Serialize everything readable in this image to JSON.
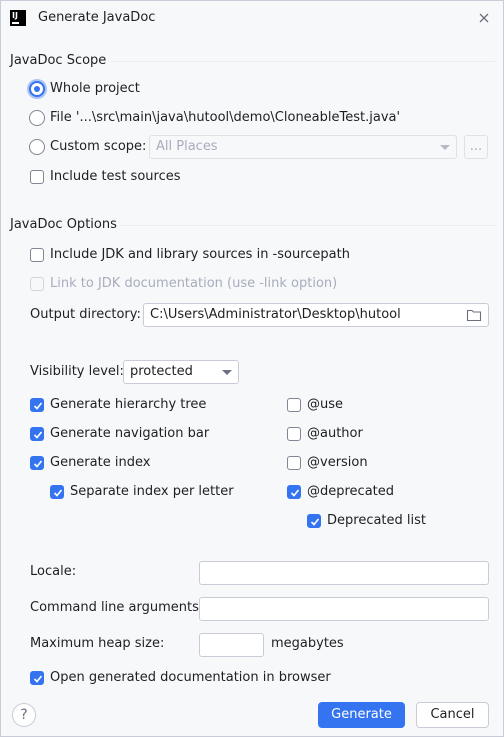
{
  "window": {
    "title": "Generate JavaDoc",
    "app_icon": "IJ"
  },
  "scope": {
    "section_title": "JavaDoc Scope",
    "whole_project_label": "Whole project",
    "file_label": "File '...\\src\\main\\java\\hutool\\demo\\CloneableTest.java'",
    "custom_scope_label": "Custom scope:",
    "custom_scope_value": "All Places",
    "browse_label": "...",
    "include_test_label": "Include test sources"
  },
  "options": {
    "section_title": "JavaDoc Options",
    "include_jdk_label": "Include JDK and library sources in -sourcepath",
    "link_jdk_label": "Link to JDK documentation (use -link option)",
    "output_dir_label": "Output directory:",
    "output_dir_value": "C:\\Users\\Administrator\\Desktop\\hutool",
    "visibility_label": "Visibility level:",
    "visibility_value": "protected",
    "hierarchy_label": "Generate hierarchy tree",
    "navbar_label": "Generate navigation bar",
    "index_label": "Generate index",
    "separate_index_label": "Separate index per letter",
    "use_label": "@use",
    "author_label": "@author",
    "version_label": "@version",
    "deprecated_label": "@deprecated",
    "deprecated_list_label": "Deprecated list",
    "locale_label": "Locale:",
    "locale_value": "",
    "cmdline_label": "Command line arguments:",
    "cmdline_value": "",
    "heap_label": "Maximum heap size:",
    "heap_value": "",
    "heap_unit": "megabytes",
    "open_browser_label": "Open generated documentation in browser"
  },
  "buttons": {
    "help": "?",
    "generate": "Generate",
    "cancel": "Cancel"
  },
  "state": {
    "scope_selected": "whole_project",
    "include_test": false,
    "include_jdk": false,
    "link_jdk": false,
    "hierarchy": true,
    "navbar": true,
    "index": true,
    "separate_index": true,
    "use": false,
    "author": false,
    "version": false,
    "deprecated": true,
    "deprecated_list": true,
    "open_browser": true
  },
  "colors": {
    "accent": "#3574f0",
    "background": "#f7f8fa",
    "disabled_text": "#a8adbd"
  }
}
